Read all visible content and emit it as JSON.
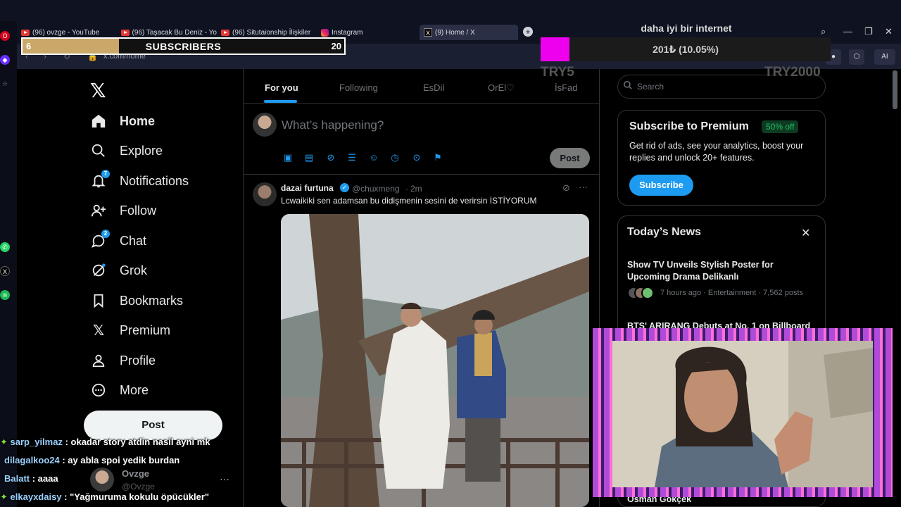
{
  "browser": {
    "tabs": [
      {
        "label": "(96) ovzge - YouTube",
        "icon": "youtube-icon"
      },
      {
        "label": "(96) Taşacak Bu Deniz - Yo",
        "icon": "youtube-icon"
      },
      {
        "label": "(96) Situtaionship İlişkiler",
        "icon": "youtube-icon"
      },
      {
        "label": "Instagram",
        "icon": "instagram-icon"
      },
      {
        "label": "(9) Home / X",
        "icon": "x-icon",
        "active": true
      }
    ],
    "url": "x.com/home",
    "ai_button": "AI"
  },
  "overlays": {
    "subscribers": {
      "label": "SUBSCRIBERS",
      "current": "6",
      "goal": "20",
      "progress": 0.3
    },
    "donation": {
      "title": "daha iyi bir internet",
      "amount": "201₺ (10.05%)",
      "progress": 0.1005,
      "min": "TRY5",
      "max": "TRY2000"
    }
  },
  "sidebar": {
    "items": [
      {
        "label": "Home",
        "icon": "home-icon",
        "active": true
      },
      {
        "label": "Explore",
        "icon": "search-icon"
      },
      {
        "label": "Notifications",
        "icon": "bell-icon",
        "badge": "7"
      },
      {
        "label": "Follow",
        "icon": "follow-icon"
      },
      {
        "label": "Chat",
        "icon": "chat-icon",
        "badge": "2"
      },
      {
        "label": "Grok",
        "icon": "grok-icon"
      },
      {
        "label": "Bookmarks",
        "icon": "bookmark-icon"
      },
      {
        "label": "Premium",
        "icon": "x-icon"
      },
      {
        "label": "Profile",
        "icon": "profile-icon"
      },
      {
        "label": "More",
        "icon": "more-icon"
      }
    ],
    "post_button": "Post",
    "account": {
      "name": "Ovzge",
      "handle": "@Ovzge"
    }
  },
  "timeline": {
    "tabs": [
      "For you",
      "Following",
      "EsDil",
      "OrEl♡",
      "İsFad"
    ],
    "compose_placeholder": "What’s happening?",
    "post_button": "Post",
    "tweet": {
      "name": "dazai furtuna",
      "handle": "@chuxmeng",
      "time": "2m",
      "text": "Lcwaikiki sen adamsan bu didişmenin sesini de verirsin İSTİYORUM"
    }
  },
  "right": {
    "search_placeholder": "Search",
    "premium": {
      "title": "Subscribe to Premium",
      "badge": "50% off",
      "desc": "Get rid of ads, see your analytics, boost your replies and unlock 20+ features.",
      "button": "Subscribe"
    },
    "news": {
      "title": "Today’s News",
      "items": [
        {
          "title": "Show TV Unveils Stylish Poster for Upcoming Drama Delikanlı",
          "meta": "7 hours ago · Entertainment · 7,562 posts"
        },
        {
          "title": "BTS' ARIRANG Debuts at No. 1 on Billboard"
        }
      ],
      "bottom_name": "Osman Gökçek"
    }
  },
  "chat": [
    {
      "user": "sarp_yilmaz",
      "msg": " : okadar story atdin nasil ayni mk"
    },
    {
      "user": "dilagalkoo24",
      "msg": " : ay abla spoi yedik burdan"
    },
    {
      "user": "Balatt",
      "msg": " : aaaa"
    },
    {
      "user": "elkayxdaisy",
      "msg": " : \"Yağmuruma kokulu öpücükler\""
    }
  ],
  "colors": {
    "accent": "#1d9bf0",
    "background": "#000000",
    "donation": "#ee00ee",
    "subscribers": "#c9a86a"
  }
}
